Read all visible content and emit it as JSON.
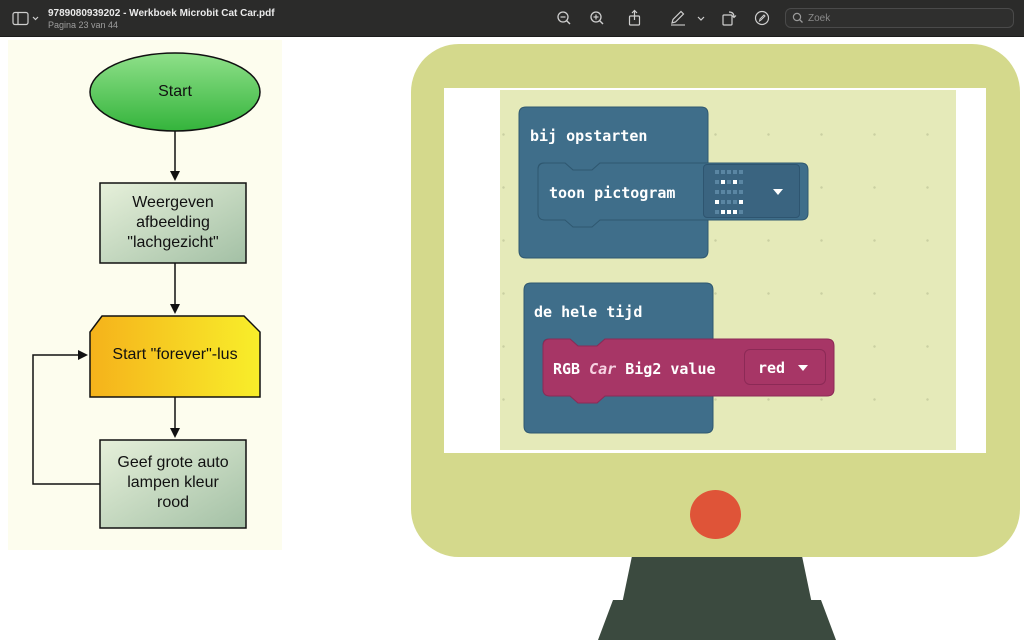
{
  "toolbar": {
    "title": "9789080939202 -  Werkboek Microbit Cat Car.pdf",
    "subtitle": "Pagina 23 van 44",
    "search_placeholder": "Zoek"
  },
  "flowchart": {
    "start": "Start",
    "step1": [
      "Weergeven",
      "afbeelding",
      "\"lachgezicht\""
    ],
    "loop": "Start \"forever\"-lus",
    "step2": [
      "Geef grote auto",
      "lampen kleur",
      "rood"
    ],
    "colors": {
      "start_green": "#4fc94f",
      "loop_yellow": "#f7d21a",
      "box_green": "#c5dcc0"
    }
  },
  "blocks": {
    "on_start": "bij opstarten",
    "show_icon": "toon pictogram",
    "forever": "de hele tijd",
    "rgb_prefix": "RGB",
    "rgb_car": "Car",
    "rgb_suffix": "Big2 value",
    "rgb_value": "red",
    "colors": {
      "basic_blue": "#3f6e8a",
      "ext_magenta": "#a73666",
      "workspace": "#e5eab9"
    }
  },
  "monitor": {
    "frame_color": "#d4d98c",
    "stand_color": "#3b4a3f",
    "power_color": "#df5438"
  }
}
